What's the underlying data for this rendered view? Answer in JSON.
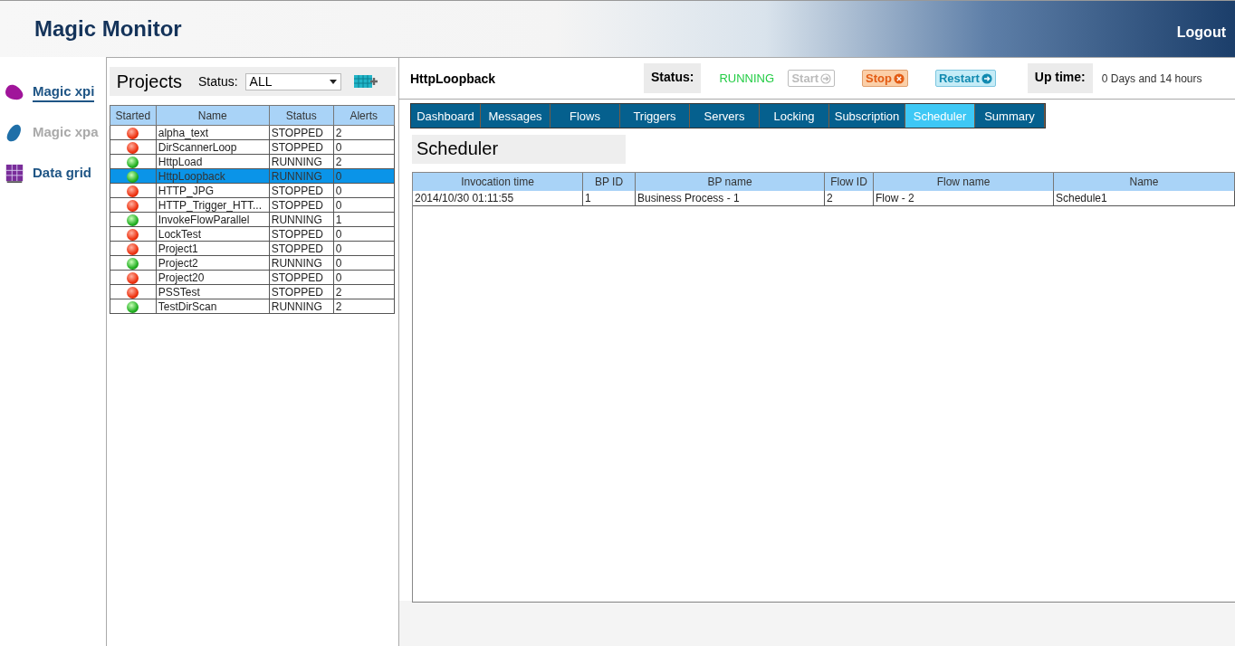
{
  "header": {
    "title": "Magic Monitor",
    "logout": "Logout"
  },
  "sidebar": {
    "items": [
      {
        "label": "Magic xpi",
        "kind": "xpi",
        "selected": true,
        "disabled": false
      },
      {
        "label": "Magic xpa",
        "kind": "xpa",
        "selected": false,
        "disabled": true
      },
      {
        "label": "Data grid",
        "kind": "grid",
        "selected": false,
        "disabled": false
      }
    ]
  },
  "projects": {
    "title": "Projects",
    "filter_label": "Status:",
    "filter_value": "ALL",
    "columns": [
      "Started",
      "Name",
      "Status",
      "Alerts"
    ],
    "rows": [
      {
        "started": false,
        "name": "alpha_text",
        "status": "STOPPED",
        "alerts": "2",
        "selected": false
      },
      {
        "started": false,
        "name": "DirScannerLoop",
        "status": "STOPPED",
        "alerts": "0",
        "selected": false
      },
      {
        "started": true,
        "name": "HttpLoad",
        "status": "RUNNING",
        "alerts": "2",
        "selected": false
      },
      {
        "started": true,
        "name": "HttpLoopback",
        "status": "RUNNING",
        "alerts": "0",
        "selected": true
      },
      {
        "started": false,
        "name": "HTTP_JPG",
        "status": "STOPPED",
        "alerts": "0",
        "selected": false
      },
      {
        "started": false,
        "name": "HTTP_Trigger_HTT...",
        "status": "STOPPED",
        "alerts": "0",
        "selected": false
      },
      {
        "started": true,
        "name": "InvokeFlowParallel",
        "status": "RUNNING",
        "alerts": "1",
        "selected": false
      },
      {
        "started": false,
        "name": "LockTest",
        "status": "STOPPED",
        "alerts": "0",
        "selected": false
      },
      {
        "started": false,
        "name": "Project1",
        "status": "STOPPED",
        "alerts": "0",
        "selected": false
      },
      {
        "started": true,
        "name": "Project2",
        "status": "RUNNING",
        "alerts": "0",
        "selected": false
      },
      {
        "started": false,
        "name": "Project20",
        "status": "STOPPED",
        "alerts": "0",
        "selected": false
      },
      {
        "started": false,
        "name": "PSSTest",
        "status": "STOPPED",
        "alerts": "2",
        "selected": false
      },
      {
        "started": true,
        "name": "TestDirScan",
        "status": "RUNNING",
        "alerts": "2",
        "selected": false
      }
    ]
  },
  "detail": {
    "project": "HttpLoopback",
    "status_label": "Status:",
    "status_value": "RUNNING",
    "buttons": [
      {
        "label": "Start",
        "kind": "start",
        "disabled": true
      },
      {
        "label": "Stop",
        "kind": "stop",
        "disabled": false
      },
      {
        "label": "Restart",
        "kind": "restart",
        "disabled": false
      }
    ],
    "uptime_label": "Up time:",
    "uptime_value": "0 Days and 14 hours",
    "tabs": [
      {
        "label": "Dashboard",
        "selected": false
      },
      {
        "label": "Messages",
        "selected": false
      },
      {
        "label": "Flows",
        "selected": false
      },
      {
        "label": "Triggers",
        "selected": false
      },
      {
        "label": "Servers",
        "selected": false
      },
      {
        "label": "Locking",
        "selected": false
      },
      {
        "label": "Subscription",
        "selected": false
      },
      {
        "label": "Scheduler",
        "selected": true
      },
      {
        "label": "Summary",
        "selected": false
      }
    ],
    "section_title": "Scheduler",
    "table": {
      "columns": [
        "Invocation time",
        "BP ID",
        "BP name",
        "Flow ID",
        "Flow name",
        "Name"
      ],
      "rows": [
        [
          "2014/10/30 01:11:55",
          "1",
          "Business Process - 1",
          "2",
          "Flow - 2",
          "Schedule1"
        ]
      ]
    }
  }
}
